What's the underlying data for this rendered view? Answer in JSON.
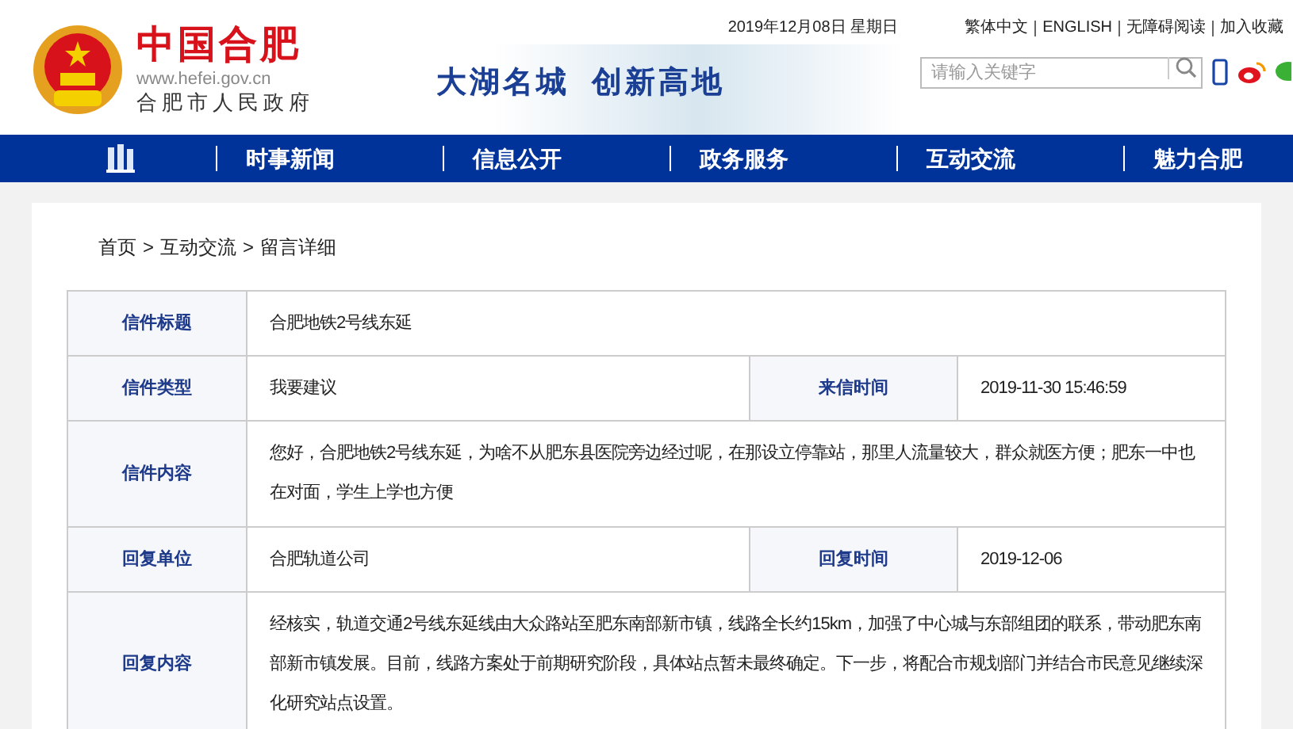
{
  "header": {
    "site_name": "中国合肥",
    "url": "www.hefei.gov.cn",
    "government": "合肥市人民政府",
    "slogan": [
      "大湖名城",
      "创新高地"
    ],
    "date": "2019年12月08日 星期日",
    "links": [
      "繁体中文",
      "ENGLISH",
      "无障碍阅读",
      "加入收藏"
    ],
    "search": {
      "placeholder": "请输入关键字"
    }
  },
  "nav": {
    "items": [
      {
        "label": "时事新闻"
      },
      {
        "label": "信息公开"
      },
      {
        "label": "政务服务"
      },
      {
        "label": "互动交流"
      },
      {
        "label": "魅力合肥"
      }
    ]
  },
  "breadcrumb": [
    "首页",
    "互动交流",
    "留言详细"
  ],
  "separator": ">",
  "table": {
    "rows": [
      {
        "cells": [
          {
            "label": "信件标题",
            "value": "合肥地铁2号线东延"
          }
        ]
      },
      {
        "cells": [
          {
            "label": "信件类型",
            "value": "我要建议"
          },
          {
            "label": "来信时间",
            "value": "2019-11-30 15:46:59"
          }
        ]
      },
      {
        "cells": [
          {
            "label": "信件内容",
            "value": "您好，合肥地铁2号线东延，为啥不从肥东县医院旁边经过呢，在那设立停靠站，那里人流量较大，群众就医方便；肥东一中也在对面，学生上学也方便"
          }
        ]
      },
      {
        "cells": [
          {
            "label": "回复单位",
            "value": "合肥轨道公司"
          },
          {
            "label": "回复时间",
            "value": "2019-12-06"
          }
        ]
      },
      {
        "cells": [
          {
            "label": "回复内容",
            "value": "经核实，轨道交通2号线东延线由大众路站至肥东南部新市镇，线路全长约15km，加强了中心城与东部组团的联系，带动肥东南部新市镇发展。目前，线路方案处于前期研究阶段，具体站点暂未最终确定。下一步，将配合市规划部门并结合市民意见继续深化研究站点设置。"
          }
        ]
      }
    ]
  }
}
